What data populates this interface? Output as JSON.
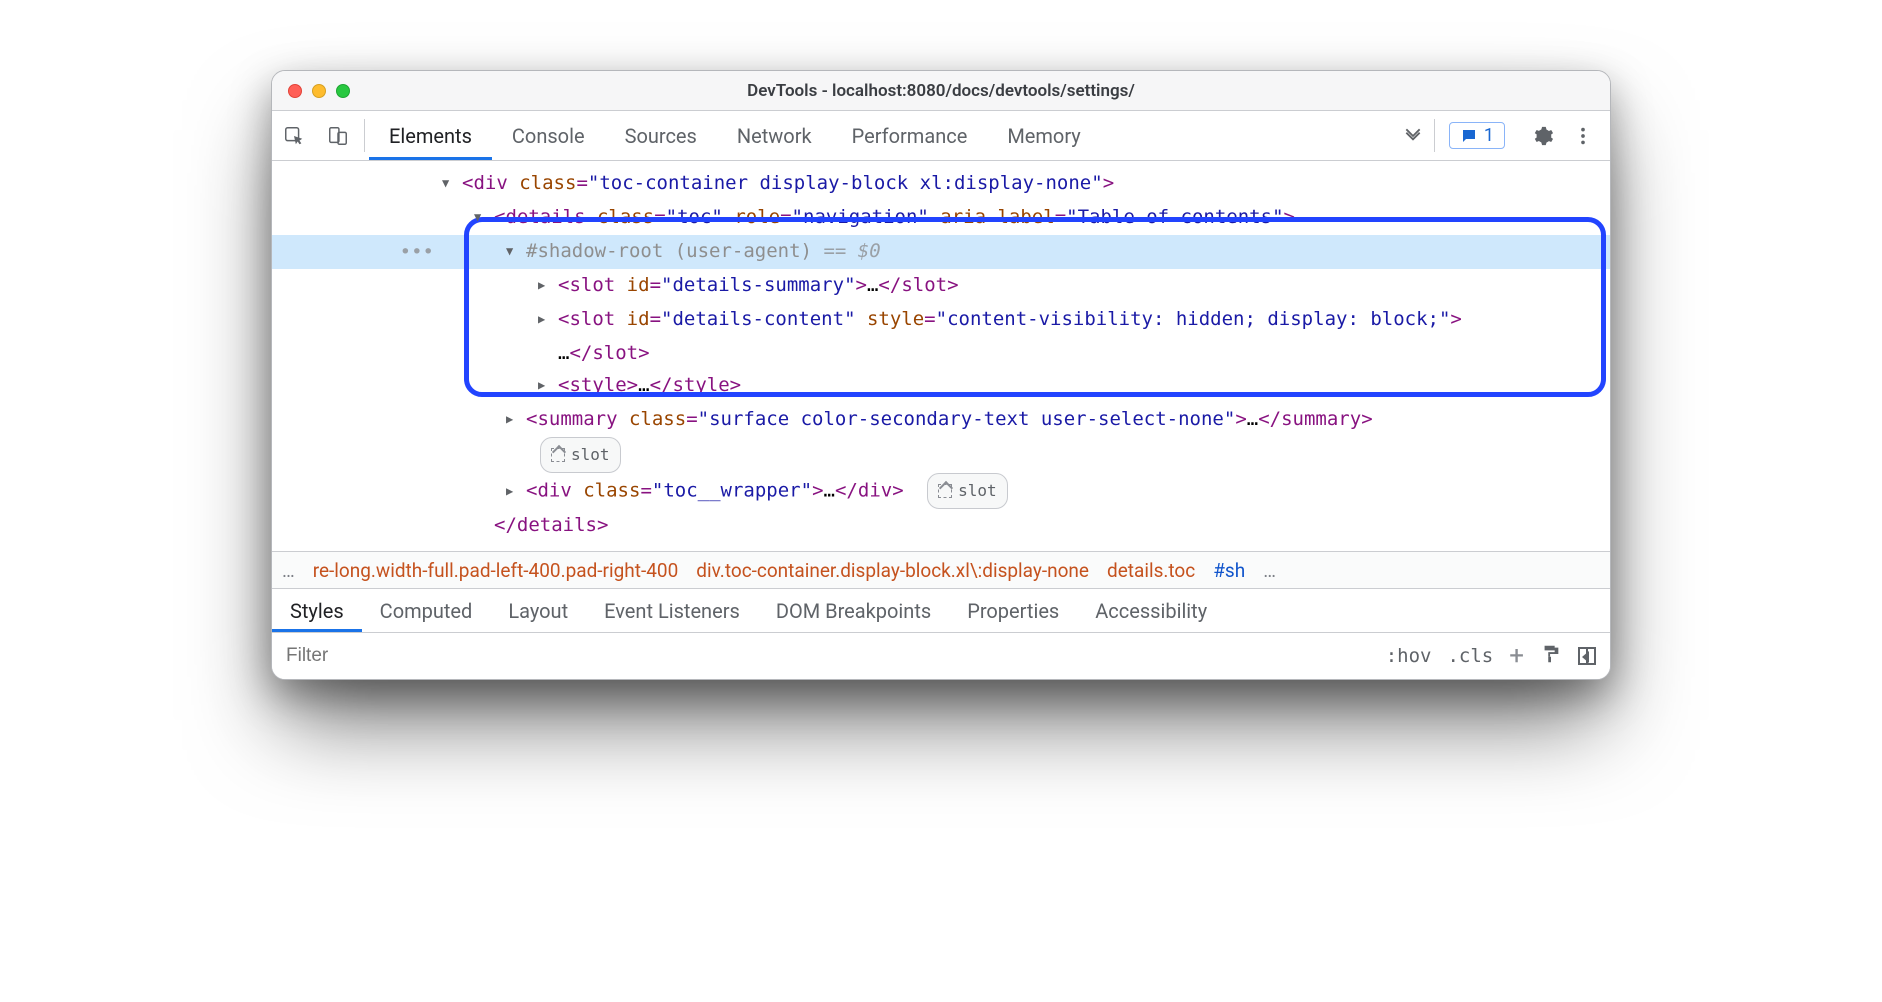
{
  "window": {
    "title": "DevTools - localhost:8080/docs/devtools/settings/"
  },
  "toolbar": {
    "tabs": [
      "Elements",
      "Console",
      "Sources",
      "Network",
      "Performance",
      "Memory"
    ],
    "active_tab_index": 0,
    "issues_count": "1"
  },
  "tree": {
    "gutter_highlight": "•••",
    "l1": {
      "tag": "div",
      "attrs": [
        {
          "n": "class",
          "v": "toc-container display-block xl:display-none"
        }
      ]
    },
    "l2": {
      "tag": "details",
      "attrs": [
        {
          "n": "class",
          "v": "toc"
        },
        {
          "n": "role",
          "v": "navigation"
        },
        {
          "n": "aria-label",
          "v": "Table of contents"
        }
      ]
    },
    "shadow": {
      "label": "#shadow-root (user-agent)",
      "eq": "== $0"
    },
    "slot_summary": {
      "tag": "slot",
      "attrs": [
        {
          "n": "id",
          "v": "details-summary"
        }
      ]
    },
    "slot_content": {
      "tag": "slot",
      "attrs": [
        {
          "n": "id",
          "v": "details-content"
        },
        {
          "n": "style",
          "v": "content-visibility: hidden; display: block;"
        }
      ]
    },
    "slot_close": {
      "text": "…",
      "close": "slot"
    },
    "style_node": {
      "tag": "style"
    },
    "summary": {
      "tag": "summary",
      "attrs": [
        {
          "n": "class",
          "v": "surface color-secondary-text user-select-none"
        }
      ]
    },
    "slot_chip": "slot",
    "toc_wrapper": {
      "tag": "div",
      "attrs": [
        {
          "n": "class",
          "v": "toc__wrapper"
        }
      ]
    },
    "details_close": "details"
  },
  "breadcrumbs": {
    "leading_ellipsis": "…",
    "items": [
      "re-long.width-full.pad-left-400.pad-right-400",
      "div.toc-container.display-block.xl\\:display-none",
      "details.toc"
    ],
    "trailing_partial": "#sh",
    "trailing_ellipsis": "…"
  },
  "subtabs": {
    "items": [
      "Styles",
      "Computed",
      "Layout",
      "Event Listeners",
      "DOM Breakpoints",
      "Properties",
      "Accessibility"
    ],
    "active_index": 0
  },
  "filterbar": {
    "placeholder": "Filter",
    "hov": ":hov",
    "cls": ".cls"
  }
}
